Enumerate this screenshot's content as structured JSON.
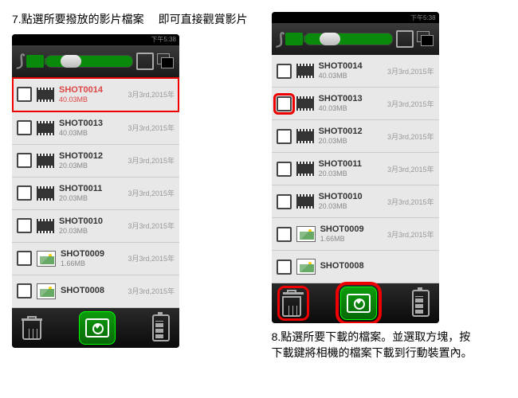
{
  "step7": {
    "text": "7.點選所要撥放的影片檔案\n　即可直接觀賞影片"
  },
  "step8": {
    "text": "8.點選所要下載的檔案。並選取方塊，按下載鍵將相機的檔案下載到行動裝置內。"
  },
  "status_time": "下午5:38",
  "left_phone": {
    "rows": [
      {
        "name": "SHOT0014",
        "size": "40.03MB",
        "date": "3月3rd,2015年",
        "type": "film",
        "selected": true
      },
      {
        "name": "SHOT0013",
        "size": "40.03MB",
        "date": "3月3rd,2015年",
        "type": "film"
      },
      {
        "name": "SHOT0012",
        "size": "20.03MB",
        "date": "3月3rd,2015年",
        "type": "film"
      },
      {
        "name": "SHOT0011",
        "size": "20.03MB",
        "date": "3月3rd,2015年",
        "type": "film"
      },
      {
        "name": "SHOT0010",
        "size": "20.03MB",
        "date": "3月3rd,2015年",
        "type": "film"
      },
      {
        "name": "SHOT0009",
        "size": "1.66MB",
        "date": "3月3rd,2015年",
        "type": "pic"
      },
      {
        "name": "SHOT0008",
        "size": "",
        "date": "3月3rd,2015年",
        "type": "pic"
      }
    ]
  },
  "right_phone": {
    "rows": [
      {
        "name": "SHOT0014",
        "size": "40.03MB",
        "date": "3月3rd,2015年",
        "type": "film"
      },
      {
        "name": "SHOT0013",
        "size": "40.03MB",
        "date": "3月3rd,2015年",
        "type": "film",
        "chk_hl": true
      },
      {
        "name": "SHOT0012",
        "size": "20.03MB",
        "date": "3月3rd,2015年",
        "type": "film"
      },
      {
        "name": "SHOT0011",
        "size": "20.03MB",
        "date": "3月3rd,2015年",
        "type": "film"
      },
      {
        "name": "SHOT0010",
        "size": "20.03MB",
        "date": "3月3rd,2015年",
        "type": "film"
      },
      {
        "name": "SHOT0009",
        "size": "1.66MB",
        "date": "3月3rd,2015年",
        "type": "pic"
      },
      {
        "name": "SHOT0008",
        "size": "",
        "date": "",
        "type": "pic"
      }
    ]
  }
}
